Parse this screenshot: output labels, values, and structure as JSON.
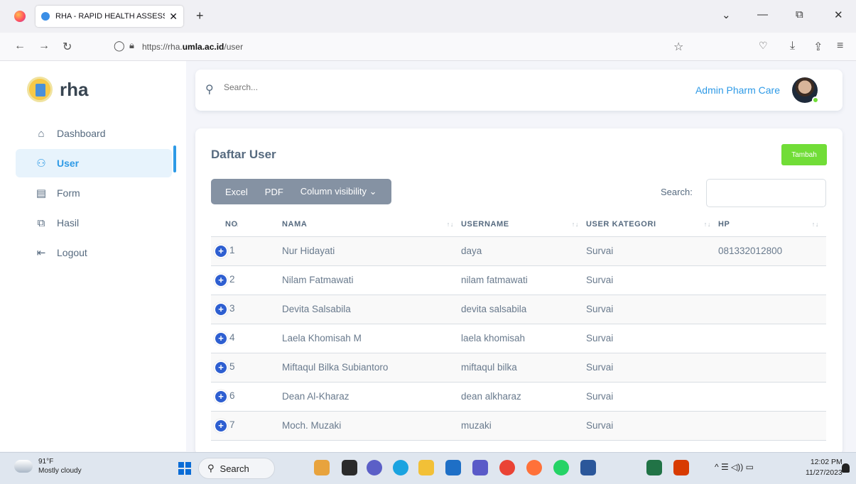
{
  "browser": {
    "tab_title": "RHA - RAPID HEALTH ASSESSM",
    "tab_close": "✕",
    "new_tab": "+",
    "url_prefix": "https://rha.",
    "url_domain": "umla.ac.id",
    "url_path": "/user",
    "window_controls": [
      "⌄",
      "—",
      "⧉",
      "✕"
    ],
    "nav_icons": [
      "back-icon",
      "forward-icon",
      "reload-icon",
      "shield-icon",
      "lock-icon",
      "star-icon",
      "pocket-icon",
      "download-icon",
      "share-icon",
      "menu-icon"
    ]
  },
  "sidebar": {
    "brand": "rha",
    "items": [
      {
        "label": "Dashboard",
        "icon": "⌂",
        "active": false
      },
      {
        "label": "User",
        "icon": "⚇",
        "active": true
      },
      {
        "label": "Form",
        "icon": "▤",
        "active": false
      },
      {
        "label": "Hasil",
        "icon": "⧉",
        "active": false
      },
      {
        "label": "Logout",
        "icon": "⇤",
        "active": false
      }
    ]
  },
  "header": {
    "search_placeholder": "Search...",
    "user_name": "Admin Pharm Care"
  },
  "main": {
    "title": "Daftar User",
    "add_button": "Tambah",
    "export_buttons": [
      "Excel",
      "PDF",
      "Column visibility ⌄"
    ],
    "search_label": "Search:",
    "columns": [
      "NO",
      "NAMA",
      "USERNAME",
      "USER KATEGORI",
      "HP"
    ],
    "rows": [
      {
        "no": "1",
        "nama": "Nur Hidayati",
        "username": "daya",
        "kategori": "Survai",
        "hp": "081332012800"
      },
      {
        "no": "2",
        "nama": "Nilam Fatmawati",
        "username": "nilam fatmawati",
        "kategori": "Survai",
        "hp": ""
      },
      {
        "no": "3",
        "nama": "Devita Salsabila",
        "username": "devita salsabila",
        "kategori": "Survai",
        "hp": ""
      },
      {
        "no": "4",
        "nama": "Laela Khomisah M",
        "username": "laela khomisah",
        "kategori": "Survai",
        "hp": ""
      },
      {
        "no": "5",
        "nama": "Miftaqul Bilka Subiantoro",
        "username": "miftaqul bilka",
        "kategori": "Survai",
        "hp": ""
      },
      {
        "no": "6",
        "nama": "Dean Al-Kharaz",
        "username": "dean alkharaz",
        "kategori": "Survai",
        "hp": ""
      },
      {
        "no": "7",
        "nama": "Moch. Muzaki",
        "username": "muzaki",
        "kategori": "Survai",
        "hp": ""
      }
    ]
  },
  "taskbar": {
    "temp": "91°F",
    "weather": "Mostly cloudy",
    "search": "Search",
    "time": "12:02 PM",
    "date": "11/27/2023",
    "tray": "^  ☰  ◁)) ▭"
  },
  "colors": {
    "accent": "#2e9ae6",
    "add_button": "#71dd37",
    "button_group": "#8592a3"
  }
}
